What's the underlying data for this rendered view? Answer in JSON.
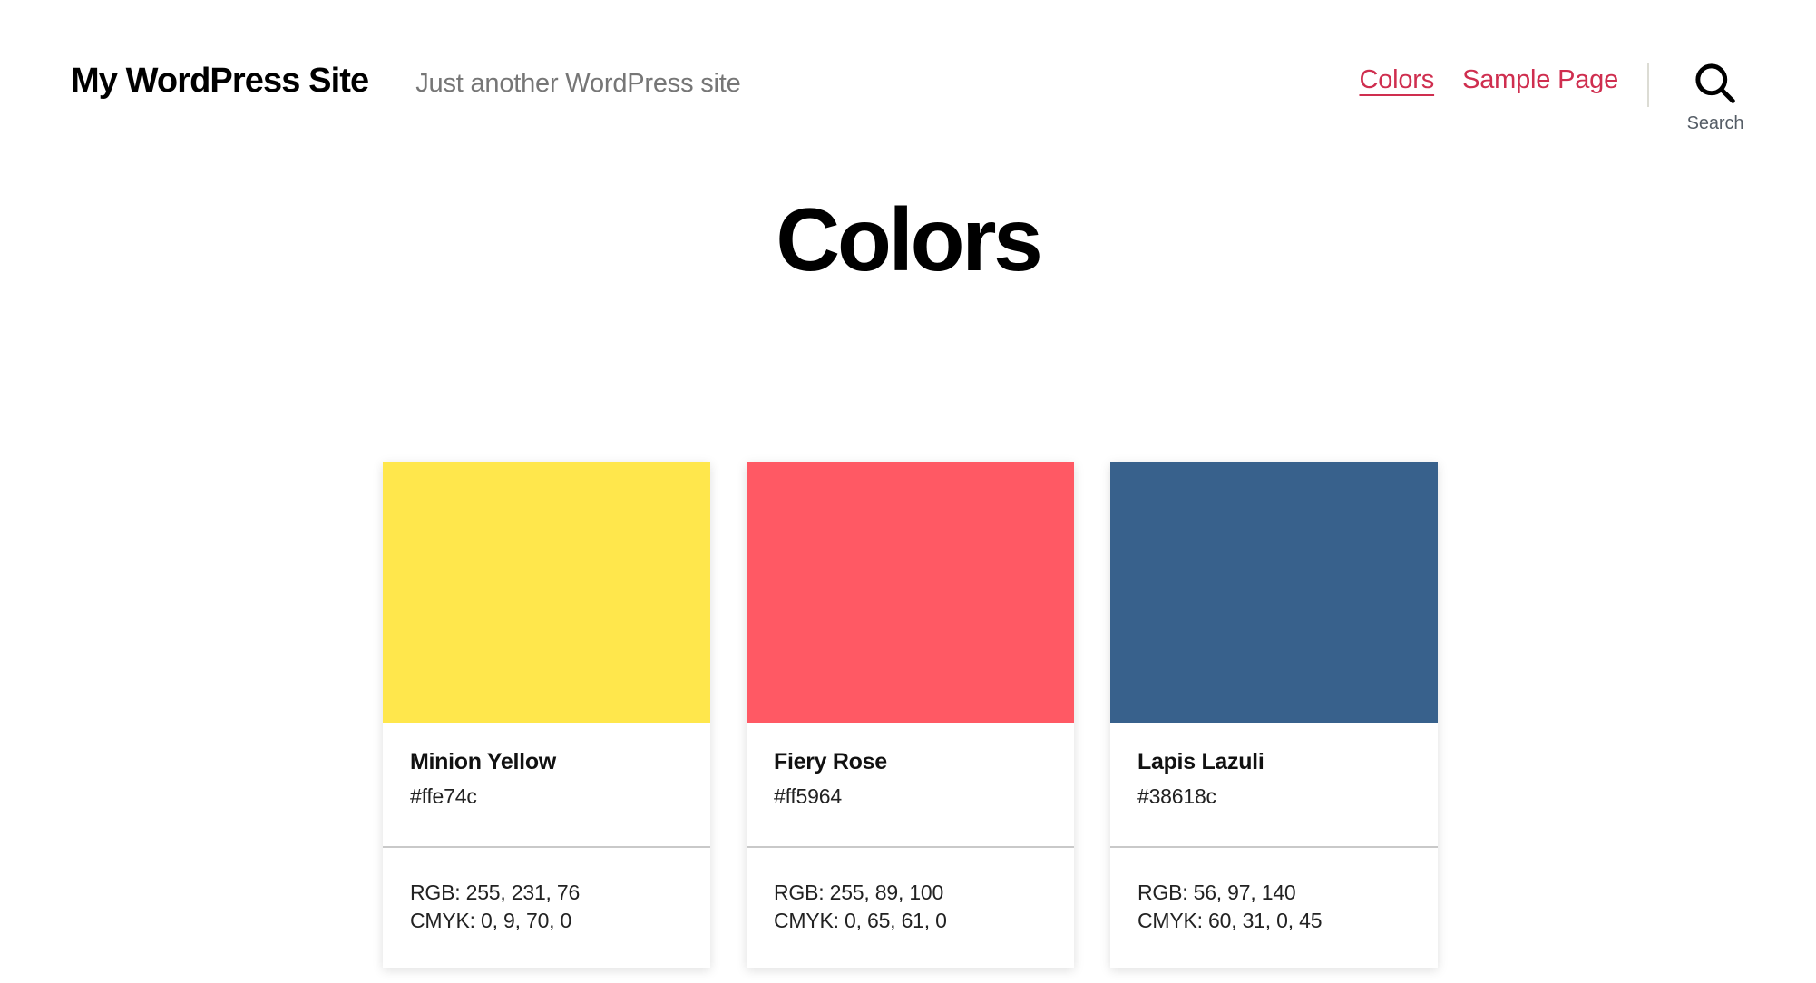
{
  "header": {
    "site_title": "My WordPress Site",
    "site_description": "Just another WordPress site",
    "nav": [
      {
        "label": "Colors",
        "current": true
      },
      {
        "label": "Sample Page",
        "current": false
      }
    ],
    "search": {
      "label": "Search",
      "icon": "search-icon"
    },
    "link_color": "#cf2e4f",
    "divider_color": "#dcdcd4"
  },
  "main": {
    "page_title": "Colors",
    "cards": [
      {
        "name": "Minion Yellow",
        "hex": "#ffe74c",
        "swatch": "#ffe74c",
        "rgb": "RGB: 255, 231, 76",
        "cmyk": "CMYK: 0, 9, 70, 0"
      },
      {
        "name": "Fiery Rose",
        "hex": "#ff5964",
        "swatch": "#ff5964",
        "rgb": "RGB: 255, 89, 100",
        "cmyk": "CMYK: 0, 65, 61, 0"
      },
      {
        "name": "Lapis Lazuli",
        "hex": "#38618c",
        "swatch": "#38618c",
        "rgb": "RGB: 56, 97, 140",
        "cmyk": "CMYK: 60, 31, 0, 45"
      }
    ]
  }
}
